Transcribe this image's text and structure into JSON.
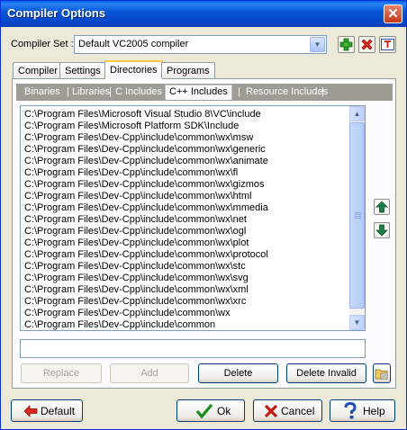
{
  "window": {
    "title": "Compiler Options",
    "close_glyph": "✕"
  },
  "compiler_set": {
    "label": "Compiler Set :",
    "value": "Default VC2005 compiler",
    "icons": [
      "add-icon",
      "delete-icon",
      "rename-icon"
    ]
  },
  "tabs": [
    "Compiler",
    "Settings",
    "Directories",
    "Programs"
  ],
  "active_tab": "Directories",
  "subtabs": [
    "Binaries",
    "Libraries",
    "C Includes",
    "C++ Includes",
    "Resource Includes"
  ],
  "active_subtab": "C++ Includes",
  "directories": [
    "C:\\Program Files\\Microsoft Visual Studio 8\\VC\\include",
    "C:\\Program Files\\Microsoft Platform SDK\\Include",
    "C:\\Program Files\\Dev-Cpp\\include\\common\\wx\\msw",
    "C:\\Program Files\\Dev-Cpp\\include\\common\\wx\\generic",
    "C:\\Program Files\\Dev-Cpp\\include\\common\\wx\\animate",
    "C:\\Program Files\\Dev-Cpp\\include\\common\\wx\\fl",
    "C:\\Program Files\\Dev-Cpp\\include\\common\\wx\\gizmos",
    "C:\\Program Files\\Dev-Cpp\\include\\common\\wx\\html",
    "C:\\Program Files\\Dev-Cpp\\include\\common\\wx\\mmedia",
    "C:\\Program Files\\Dev-Cpp\\include\\common\\wx\\net",
    "C:\\Program Files\\Dev-Cpp\\include\\common\\wx\\ogl",
    "C:\\Program Files\\Dev-Cpp\\include\\common\\wx\\plot",
    "C:\\Program Files\\Dev-Cpp\\include\\common\\wx\\protocol",
    "C:\\Program Files\\Dev-Cpp\\include\\common\\wx\\stc",
    "C:\\Program Files\\Dev-Cpp\\include\\common\\wx\\svg",
    "C:\\Program Files\\Dev-Cpp\\include\\common\\wx\\xml",
    "C:\\Program Files\\Dev-Cpp\\include\\common\\wx\\xrc",
    "C:\\Program Files\\Dev-Cpp\\include\\common\\wx",
    "C:\\Program Files\\Dev-Cpp\\include\\common"
  ],
  "path_input": {
    "value": ""
  },
  "actions": {
    "replace": "Replace",
    "add": "Add",
    "delete": "Delete",
    "delete_invalid": "Delete Invalid"
  },
  "footer": {
    "default": "Default",
    "ok": "Ok",
    "cancel": "Cancel",
    "help": "Help"
  },
  "colors": {
    "title_bar": "#0a56d8",
    "dialog_bg": "#ece9d8",
    "active_tab_highlight": "#ffc83c"
  }
}
